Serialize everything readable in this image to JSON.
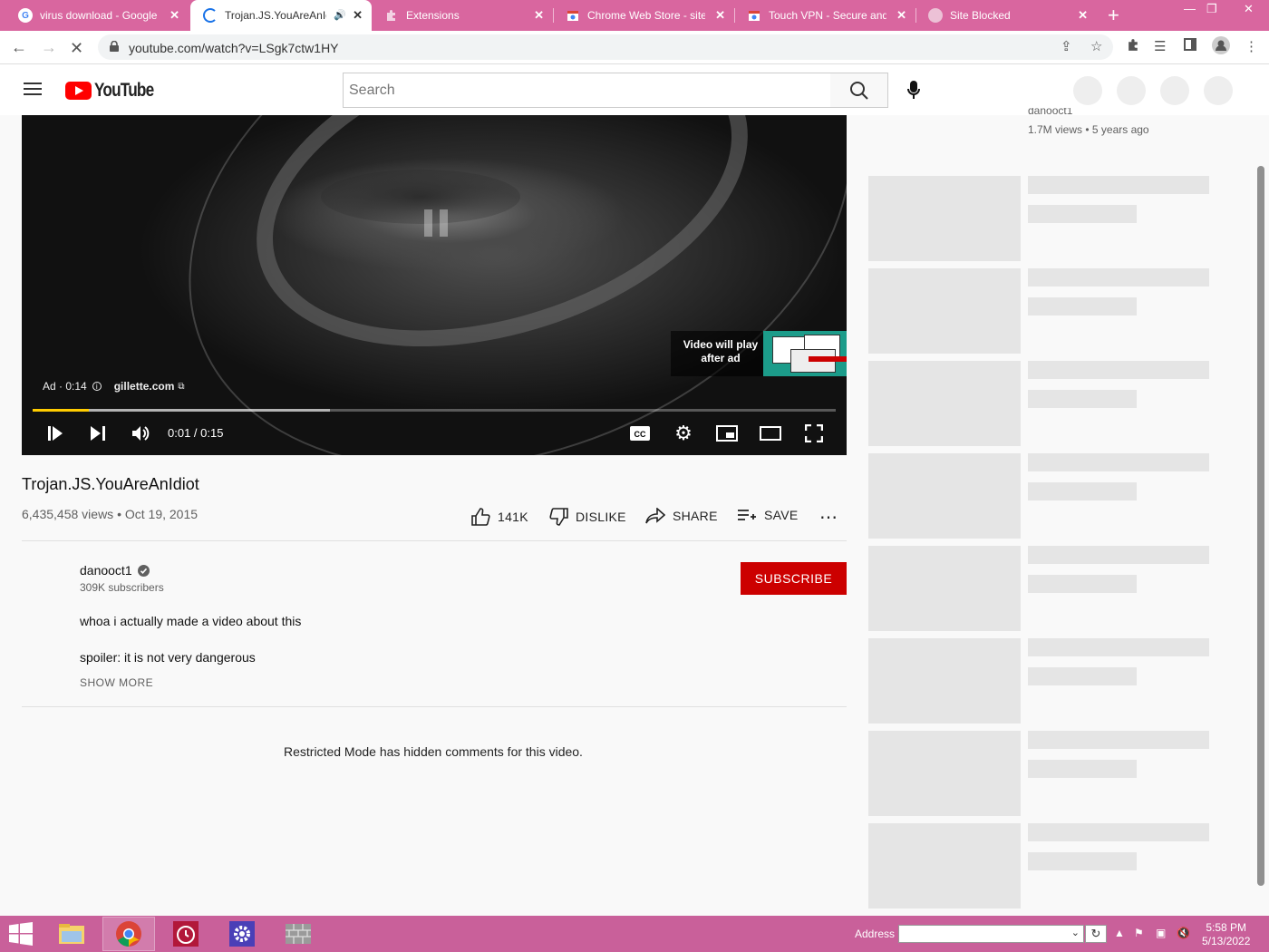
{
  "browser": {
    "tabs": [
      {
        "title": "virus download - Google",
        "favicon": "google-icon"
      },
      {
        "title": "Trojan.JS.YouAreAnId",
        "favicon": "loading-spinner-icon",
        "active": true,
        "audio": "speaker-icon"
      },
      {
        "title": "Extensions",
        "favicon": "puzzle-icon"
      },
      {
        "title": "Chrome Web Store - site",
        "favicon": "web-store-icon"
      },
      {
        "title": "Touch VPN - Secure and",
        "favicon": "web-store-icon"
      },
      {
        "title": "Site Blocked",
        "favicon": "globe-icon"
      }
    ],
    "url": "youtube.com/watch?v=LSgk7ctw1HY"
  },
  "youtube": {
    "logo_text": "YouTube",
    "search_placeholder": "Search"
  },
  "player": {
    "ad_label": "Ad · 0:14",
    "ad_link": "gillette.com",
    "skip_text": "Video will play after ad",
    "time": "0:01 / 0:15",
    "progress_played": 0.07,
    "progress_buffered": 0.37,
    "accent": "#ffcc00"
  },
  "video": {
    "title": "Trojan.JS.YouAreAnIdiot",
    "meta": "6,435,458 views • Oct 19, 2015",
    "actions": {
      "like": "141K",
      "dislike": "DISLIKE",
      "share": "SHARE",
      "save": "SAVE"
    }
  },
  "channel": {
    "name": "danooct1",
    "subscribers": "309K subscribers",
    "subscribe_label": "SUBSCRIBE"
  },
  "description": {
    "line1": "whoa i actually made a video about this",
    "line2": "spoiler: it is not very dangerous",
    "show_more": "SHOW MORE"
  },
  "comments": {
    "restricted_notice": "Restricted Mode has hidden comments for this video."
  },
  "sidebar": {
    "top_item_channel": "danooct1",
    "top_item_meta": "1.7M views • 5 years ago"
  },
  "taskbar": {
    "address_label": "Address",
    "time": "5:58 PM",
    "date": "5/13/2022"
  },
  "colors": {
    "tabstrip": "#d9669f",
    "taskbar": "#c9609a",
    "subscribe": "#cc0000",
    "yt_red": "#ff0000"
  }
}
